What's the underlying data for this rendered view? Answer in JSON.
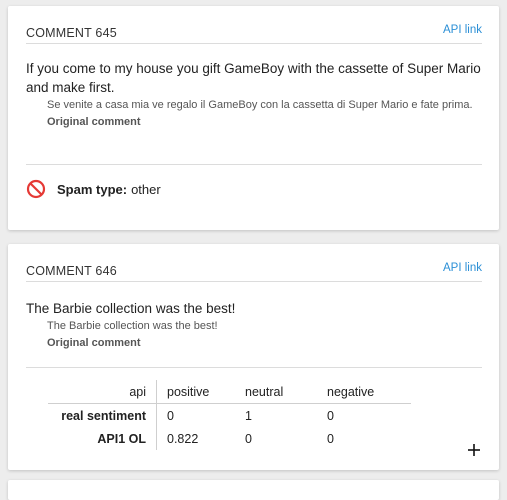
{
  "comments": [
    {
      "title": "COMMENT 645",
      "api_link": "API link",
      "text": "If you come to my house you gift GameBoy with the cassette of Super Mario and make first.",
      "original": "Se venite a casa mia ve regalo il GameBoy con la cassetta di Super Mario e fate prima.",
      "original_label": "Original comment",
      "spam_label": "Spam type:",
      "spam_value": "other",
      "spam_icon": "prohibited-icon",
      "spam_color": "#e53935"
    },
    {
      "title": "COMMENT 646",
      "api_link": "API link",
      "text": "The Barbie collection was the best!",
      "original": "The Barbie collection was the best!",
      "original_label": "Original comment",
      "table": {
        "headers": [
          "api",
          "positive",
          "neutral",
          "negative"
        ],
        "rows": [
          {
            "label": "real sentiment",
            "values": [
              "0",
              "1",
              "0"
            ]
          },
          {
            "label": "API1 OL",
            "values": [
              "0.822",
              "0",
              "0"
            ]
          }
        ]
      },
      "add_icon": "plus-icon"
    }
  ],
  "colors": {
    "link": "#2b8fd6",
    "divider": "#dcdcdc"
  }
}
